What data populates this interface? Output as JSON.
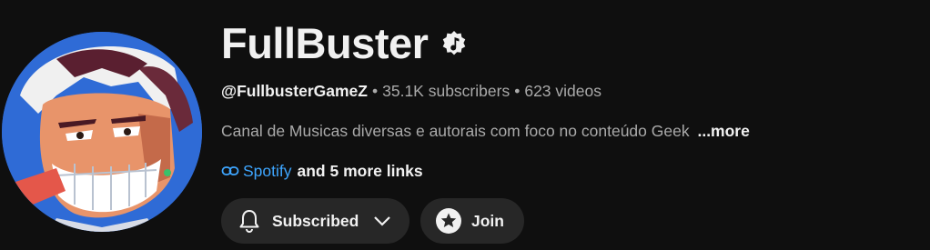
{
  "channel": {
    "name": "FullBuster",
    "verified_icon": "music-note-badge-icon",
    "handle": "@FullbusterGameZ",
    "separator": "•",
    "subscribers": "35.1K subscribers",
    "videos": "623 videos",
    "description": "Canal de Musicas diversas e autorais com foco no conteúdo Geek",
    "more_label": "...more",
    "link_icon": "link-icon",
    "primary_link": "Spotify",
    "more_links": "and 5 more links"
  },
  "actions": {
    "subscribed_label": "Subscribed",
    "subscribed_icon": "bell-icon",
    "dropdown_icon": "chevron-down-icon",
    "join_label": "Join",
    "join_icon": "star-icon"
  },
  "colors": {
    "background": "#0f0f0f",
    "text_primary": "#f1f1f1",
    "text_secondary": "#aaaaaa",
    "link": "#3ea6ff",
    "button_bg": "#272727"
  }
}
